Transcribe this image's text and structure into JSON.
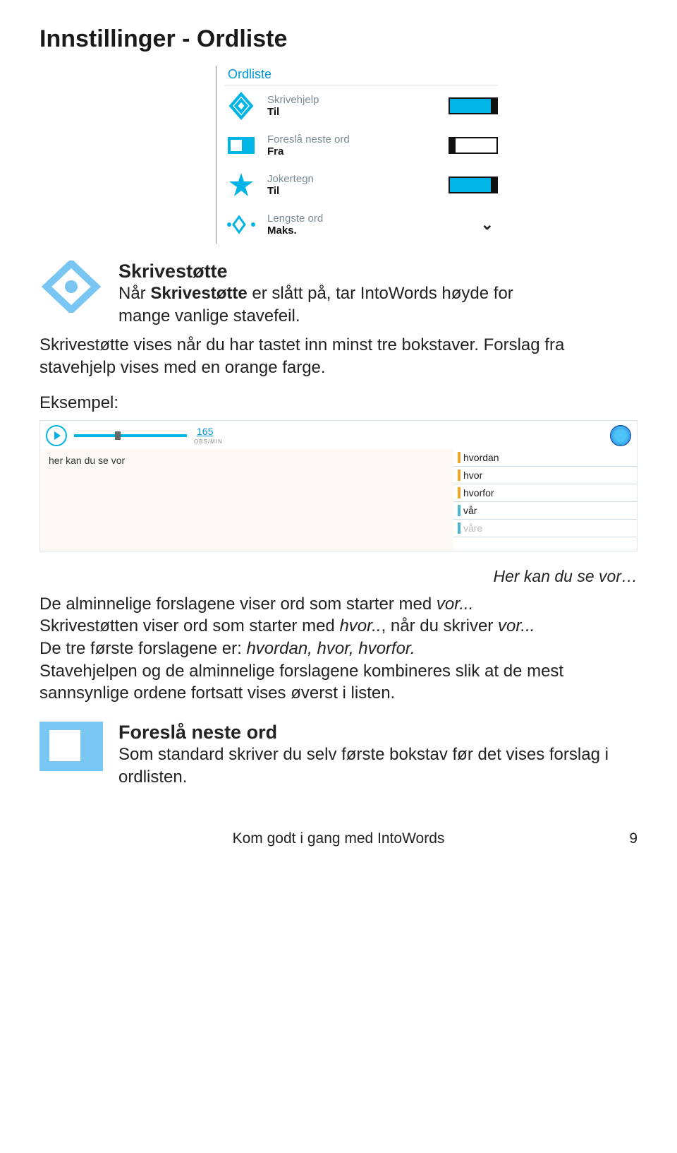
{
  "title": "Innstillinger - Ordliste",
  "settings": {
    "header": "Ordliste",
    "rows": [
      {
        "label": "Skrivehjelp",
        "state": "Til",
        "toggle": "on",
        "icon": "diamond"
      },
      {
        "label": "Foreslå neste ord",
        "state": "Fra",
        "toggle": "off",
        "icon": "next"
      },
      {
        "label": "Jokertegn",
        "state": "Til",
        "toggle": "on",
        "icon": "star"
      },
      {
        "label": "Lengste ord",
        "state": "Maks.",
        "toggle": "dropdown",
        "icon": "length"
      }
    ]
  },
  "feature1": {
    "title": "Skrivestøtte",
    "l1a": "Når ",
    "l1b": "Skrivestøtte",
    "l1c": " er slått på, tar IntoWords høyde for",
    "l2": "mange vanlige stavefeil.",
    "p2": "Skrivestøtte vises når du har tastet inn minst tre bokstaver. Forslag fra stavehjelp vises med en orange farge.",
    "eks": "Eksempel:"
  },
  "example": {
    "speed": "165",
    "speed_sub": "OBS/MIN",
    "typed": "her kan du se vor",
    "suggestions": [
      "hvordan",
      "hvor",
      "hvorfor",
      "vår",
      "våre"
    ]
  },
  "caption": "Her kan du se vor…",
  "body": {
    "l1a": "De alminnelige forslagene viser ord som starter med ",
    "l1b": "vor...",
    "l2a": "Skrivestøtten viser ord som starter med ",
    "l2b": "hvor..",
    "l2c": ", når du skriver ",
    "l2d": "vor...",
    "l3a": "De tre første forslagene er: ",
    "l3b": "hvordan, hvor, hvorfor.",
    "l4": "Stavehjelpen og de alminnelige forslagene kombineres slik at de mest sannsynlige ordene fortsatt vises øverst i listen."
  },
  "feature2": {
    "title": "Foreslå neste ord",
    "p": "Som standard skriver du selv første bokstav før det vises forslag i ordlisten."
  },
  "footer": "Kom godt i gang med IntoWords",
  "page": "9"
}
